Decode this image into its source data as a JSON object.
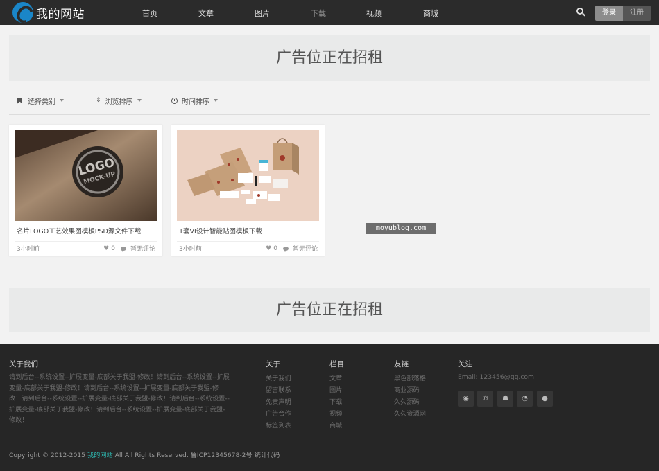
{
  "header": {
    "site_name": "我的网站",
    "nav": [
      {
        "label": "首页"
      },
      {
        "label": "文章"
      },
      {
        "label": "图片"
      },
      {
        "label": "下载"
      },
      {
        "label": "视频"
      },
      {
        "label": "商城"
      }
    ],
    "active_nav": "下载",
    "login_label": "登录",
    "register_label": "注册"
  },
  "ads": {
    "top": "广告位正在招租",
    "bottom": "广告位正在招租"
  },
  "filters": [
    {
      "label": "选择类别",
      "icon": "bookmark-icon"
    },
    {
      "label": "浏览排序",
      "icon": "sort-icon"
    },
    {
      "label": "时间排序",
      "icon": "clock-icon"
    }
  ],
  "cards": [
    {
      "title": "名片LOGO工艺效果图模板PSD源文件下载",
      "time": "3小时前",
      "likes": "0",
      "comments": "暂无评论"
    },
    {
      "title": "1套VI设计智能贴图模板下载",
      "time": "3小时前",
      "likes": "0",
      "comments": "暂无评论"
    }
  ],
  "watermark": "moyublog.com",
  "footer": {
    "about_title": "关于我们",
    "about_text": "请到后台--系统设置--扩展变量-底部关于我盟-修改！请到后台--系统设置--扩展变量-底部关于我盟-修改！请到后台--系统设置--扩展变量-底部关于我盟-修改！请到后台--系统设置--扩展变量-底部关于我盟-修改！请到后台--系统设置--扩展变量-底部关于我盟-修改！请到后台--系统设置--扩展变量-底部关于我盟-修改！",
    "col_about": {
      "title": "关于",
      "links": [
        "关于我们",
        "留言联系",
        "免责声明",
        "广告合作",
        "标签列表"
      ]
    },
    "col_column": {
      "title": "栏目",
      "links": [
        "文章",
        "图片",
        "下载",
        "视频",
        "商城"
      ]
    },
    "col_friends": {
      "title": "友链",
      "links": [
        "黑色部落格",
        "商业源码",
        "久久源码",
        "久久资源网"
      ]
    },
    "col_follow": {
      "title": "关注",
      "email": "Email: 123456@qq.com"
    },
    "social_icons": [
      "weibo-icon",
      "pinterest-icon",
      "qq-icon",
      "rss-icon",
      "wechat-icon"
    ],
    "copyright_prefix": "Copyright © 2012-2015",
    "copyright_site": "我的网站",
    "copyright_suffix": "All All Rights Reserved. 鲁ICP12345678-2号 统计代码"
  }
}
